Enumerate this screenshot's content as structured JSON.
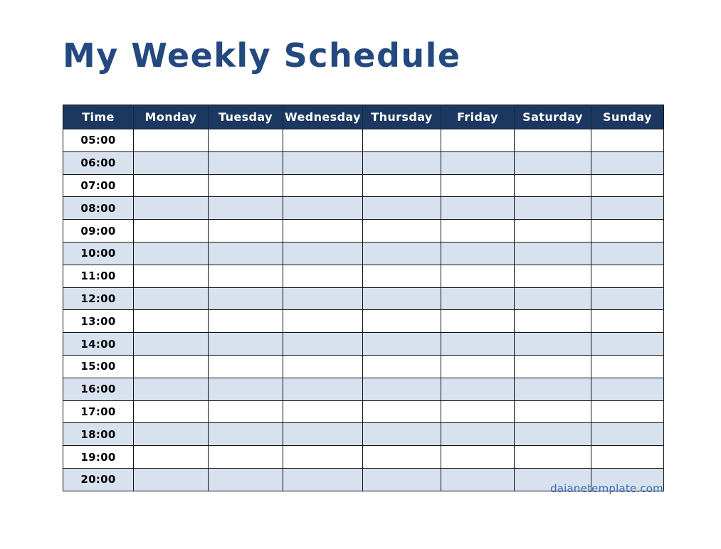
{
  "title": "My Weekly Schedule",
  "footer": {
    "credit": "daianetemplate.com"
  },
  "colors": {
    "title": "#23497f",
    "header_bg": "#1c3860",
    "header_text": "#ffffff",
    "row_alt_bg": "#d8e2ef",
    "row_bg": "#ffffff",
    "grid_line": "#111111",
    "footer_text": "#3a6bb5"
  },
  "table": {
    "columns": [
      {
        "key": "time",
        "label": "Time"
      },
      {
        "key": "monday",
        "label": "Monday"
      },
      {
        "key": "tuesday",
        "label": "Tuesday"
      },
      {
        "key": "wednesday",
        "label": "Wednesday"
      },
      {
        "key": "thursday",
        "label": "Thursday"
      },
      {
        "key": "friday",
        "label": "Friday"
      },
      {
        "key": "saturday",
        "label": "Saturday"
      },
      {
        "key": "sunday",
        "label": "Sunday"
      }
    ],
    "rows": [
      {
        "time": "05:00",
        "cells": [
          "",
          "",
          "",
          "",
          "",
          "",
          ""
        ]
      },
      {
        "time": "06:00",
        "cells": [
          "",
          "",
          "",
          "",
          "",
          "",
          ""
        ]
      },
      {
        "time": "07:00",
        "cells": [
          "",
          "",
          "",
          "",
          "",
          "",
          ""
        ]
      },
      {
        "time": "08:00",
        "cells": [
          "",
          "",
          "",
          "",
          "",
          "",
          ""
        ]
      },
      {
        "time": "09:00",
        "cells": [
          "",
          "",
          "",
          "",
          "",
          "",
          ""
        ]
      },
      {
        "time": "10:00",
        "cells": [
          "",
          "",
          "",
          "",
          "",
          "",
          ""
        ]
      },
      {
        "time": "11:00",
        "cells": [
          "",
          "",
          "",
          "",
          "",
          "",
          ""
        ]
      },
      {
        "time": "12:00",
        "cells": [
          "",
          "",
          "",
          "",
          "",
          "",
          ""
        ]
      },
      {
        "time": "13:00",
        "cells": [
          "",
          "",
          "",
          "",
          "",
          "",
          ""
        ]
      },
      {
        "time": "14:00",
        "cells": [
          "",
          "",
          "",
          "",
          "",
          "",
          ""
        ]
      },
      {
        "time": "15:00",
        "cells": [
          "",
          "",
          "",
          "",
          "",
          "",
          ""
        ]
      },
      {
        "time": "16:00",
        "cells": [
          "",
          "",
          "",
          "",
          "",
          "",
          ""
        ]
      },
      {
        "time": "17:00",
        "cells": [
          "",
          "",
          "",
          "",
          "",
          "",
          ""
        ]
      },
      {
        "time": "18:00",
        "cells": [
          "",
          "",
          "",
          "",
          "",
          "",
          ""
        ]
      },
      {
        "time": "19:00",
        "cells": [
          "",
          "",
          "",
          "",
          "",
          "",
          ""
        ]
      },
      {
        "time": "20:00",
        "cells": [
          "",
          "",
          "",
          "",
          "",
          "",
          ""
        ]
      }
    ]
  }
}
